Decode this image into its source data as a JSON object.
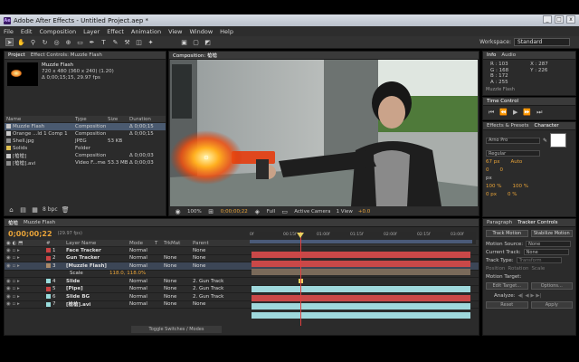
{
  "window": {
    "title": "Adobe After Effects - Untitled Project.aep *",
    "min": "_",
    "max": "□",
    "close": "x"
  },
  "menu": [
    "File",
    "Edit",
    "Composition",
    "Layer",
    "Effect",
    "Animation",
    "View",
    "Window",
    "Help"
  ],
  "workspace": {
    "label": "Workspace:",
    "value": "Standard"
  },
  "project": {
    "tabs": [
      "Project",
      "Effect Controls: Muzzle Flash"
    ],
    "preview": {
      "name": "Muzzle Flash",
      "line1": "720 x 480 (360 x 240) (1.20)",
      "line2": "Δ 0;00;15;15, 29.97 fps"
    },
    "columns": [
      "Name",
      "Type",
      "Size",
      "Duration"
    ],
    "items": [
      {
        "name": "Muzzle Flash",
        "type": "Composition",
        "size": "",
        "duration": "Δ 0;00;15",
        "color": "#c8c8c8"
      },
      {
        "name": "Orange ...ld 1 Comp 1",
        "type": "Composition",
        "size": "",
        "duration": "Δ 0;00;15",
        "color": "#c8c8c8"
      },
      {
        "name": "Shell.jpg",
        "type": "JPEG",
        "size": "53 KB",
        "duration": "",
        "color": "#8c8c8c"
      },
      {
        "name": "Solids",
        "type": "Folder",
        "size": "",
        "duration": "",
        "color": "#e0c050"
      },
      {
        "name": "[槍槍]",
        "type": "Composition",
        "size": "",
        "duration": "Δ 0;00;03",
        "color": "#c8c8c8"
      },
      {
        "name": "[槍槍].avi",
        "type": "Video F...mea",
        "size": "53.3 MB",
        "duration": "Δ 0;00;03",
        "color": "#8c8c8c"
      }
    ],
    "bpc": "8 bpc"
  },
  "composition": {
    "tab": "Composition: 槍槍",
    "zoom": "100%",
    "timecode": "0;00;00;22",
    "quality": "Full",
    "camera": "Active Camera",
    "views": "1 View",
    "exposure": "+0.0"
  },
  "info": {
    "tabs": [
      "Info",
      "Audio"
    ],
    "r": "R : 103",
    "g": "G : 168",
    "b": "B : 172",
    "a": "A : 255",
    "x": "X : 287",
    "y": "Y : 226",
    "footer": "Muzzle Flash"
  },
  "time_control": {
    "tab": "Time Control"
  },
  "effects": {
    "tabs": [
      "Effects & Presets",
      "Character"
    ],
    "font": "Arno Pro",
    "style": "Regular",
    "size": "67 px",
    "leading": "Auto",
    "tracking": "0",
    "kern": "px",
    "vscale": "100 %",
    "hscale": "100 %",
    "baseline": "0 px",
    "tsume": "0 %"
  },
  "tracker": {
    "tabs": [
      "Paragraph",
      "Tracker Controls"
    ],
    "track_motion": "Track Motion",
    "stabilize": "Stabilize Motion",
    "motion_source_label": "Motion Source:",
    "motion_source": "None",
    "current_track_label": "Current Track:",
    "current_track": "None",
    "track_type_label": "Track Type:",
    "track_type": "Transform",
    "position": "Position",
    "rotation": "Rotation",
    "scale": "Scale",
    "motion_target": "Motion Target:",
    "edit_target": "Edit Target...",
    "options": "Options...",
    "analyze": "Analyze:",
    "reset": "Reset",
    "apply": "Apply"
  },
  "timeline": {
    "tabs": [
      "槍槍",
      "Muzzle Flash"
    ],
    "timecode": "0;00;00;22",
    "fps": "(29.97 fps)",
    "columns": [
      "#",
      "Layer Name",
      "Mode",
      "T",
      "TrkMat",
      "Parent"
    ],
    "ruler": [
      "0f",
      "00:15f",
      "01:00f",
      "01:15f",
      "02:00f",
      "02:15f",
      "03:00f"
    ],
    "layers": [
      {
        "num": "1",
        "name": "Face Tracker",
        "mode": "Normal",
        "trkmat": "",
        "parent": "None",
        "color": "#c44"
      },
      {
        "num": "2",
        "name": "Gun Tracker",
        "mode": "Normal",
        "trkmat": "None",
        "parent": "None",
        "color": "#c44"
      },
      {
        "num": "3",
        "name": "[Muzzle Flash]",
        "mode": "Normal",
        "trkmat": "None",
        "parent": "None",
        "color": "#aa8a6a"
      },
      {
        "num": "4",
        "name": "Slide",
        "mode": "Normal",
        "trkmat": "None",
        "parent": "2. Gun Track",
        "color": "#9dd"
      },
      {
        "num": "5",
        "name": "[Pipe]",
        "mode": "Normal",
        "trkmat": "None",
        "parent": "2. Gun Track",
        "color": "#c44"
      },
      {
        "num": "6",
        "name": "Slide BG",
        "mode": "Normal",
        "trkmat": "None",
        "parent": "2. Gun Track",
        "color": "#9dd"
      },
      {
        "num": "7",
        "name": "[槍槍].avi",
        "mode": "Normal",
        "trkmat": "None",
        "parent": "None",
        "color": "#9dd"
      }
    ],
    "scale_prop": {
      "name": "Scale",
      "value": "118.0, 118.0%"
    },
    "footer": "Toggle Switches / Modes"
  },
  "colors": {
    "accent": "#e8a338",
    "playhead": "#e04040"
  }
}
